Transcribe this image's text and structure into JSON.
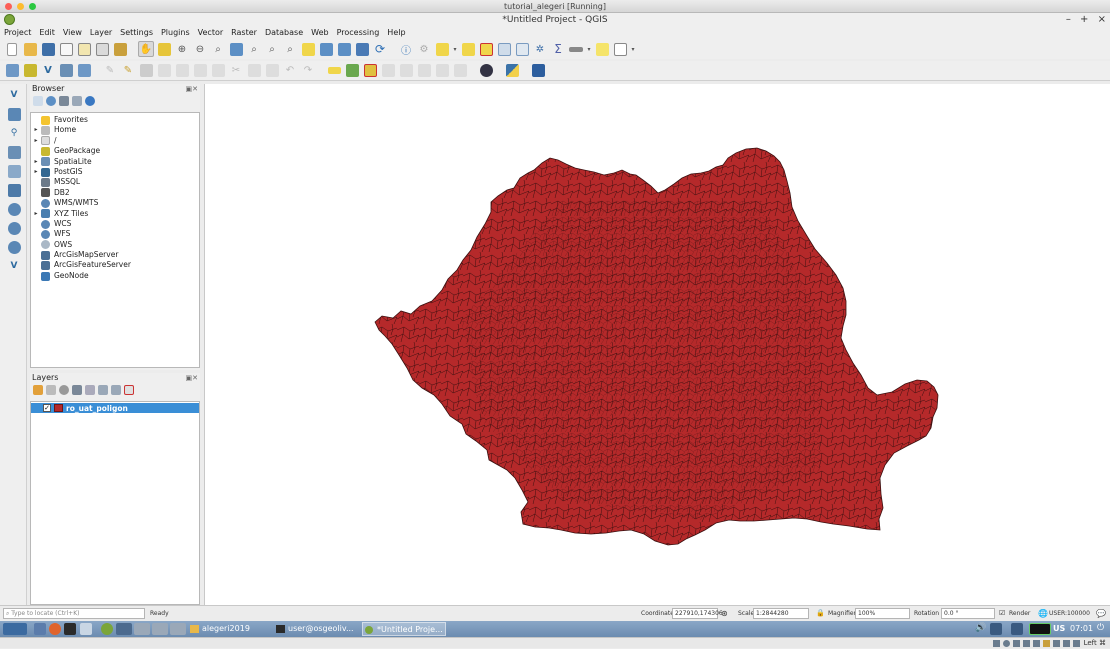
{
  "vbox_title": "tutorial_alegeri [Running]",
  "app_title": "*Untitled Project - QGIS",
  "window_controls": [
    "–",
    "+",
    "×"
  ],
  "menu": [
    "Project",
    "Edit",
    "View",
    "Layer",
    "Settings",
    "Plugins",
    "Vector",
    "Raster",
    "Database",
    "Web",
    "Processing",
    "Help"
  ],
  "browser": {
    "title": "Browser",
    "items": [
      {
        "label": "Favorites",
        "arrow": "",
        "icon": "#f4c430"
      },
      {
        "label": "Home",
        "arrow": "▸",
        "icon": "#bbbbbb"
      },
      {
        "label": "/",
        "arrow": "▸",
        "icon": "#dddddd"
      },
      {
        "label": "GeoPackage",
        "arrow": "",
        "icon": "#c8b830"
      },
      {
        "label": "SpatiaLite",
        "arrow": "▸",
        "icon": "#6a8fb5"
      },
      {
        "label": "PostGIS",
        "arrow": "▸",
        "icon": "#336791"
      },
      {
        "label": "MSSQL",
        "arrow": "",
        "icon": "#6c7a89"
      },
      {
        "label": "DB2",
        "arrow": "",
        "icon": "#555555"
      },
      {
        "label": "WMS/WMTS",
        "arrow": "",
        "icon": "#5a87b5"
      },
      {
        "label": "XYZ Tiles",
        "arrow": "▸",
        "icon": "#4a7fb0"
      },
      {
        "label": "WCS",
        "arrow": "",
        "icon": "#5a87b5"
      },
      {
        "label": "WFS",
        "arrow": "",
        "icon": "#5a87b5"
      },
      {
        "label": "OWS",
        "arrow": "",
        "icon": "#aab8c6"
      },
      {
        "label": "ArcGisMapServer",
        "arrow": "",
        "icon": "#4a6f95"
      },
      {
        "label": "ArcGisFeatureServer",
        "arrow": "",
        "icon": "#4a6f95"
      },
      {
        "label": "GeoNode",
        "arrow": "",
        "icon": "#3b78b5"
      }
    ]
  },
  "layers": {
    "title": "Layers",
    "items": [
      {
        "label": "ro_uat_poligon",
        "checked": true,
        "color": "#b5292a"
      }
    ]
  },
  "status": {
    "locate_placeholder": "Type to locate (Ctrl+K)",
    "ready": "Ready",
    "coordinate_label": "Coordinate",
    "coordinate_value": "227910,174306",
    "scale_label": "Scale",
    "scale_value": "1:2844280",
    "magnifier_label": "Magnifier",
    "magnifier_value": "100%",
    "rotation_label": "Rotation",
    "rotation_value": "0.0 °",
    "render_label": "Render",
    "crs": "USER:100000"
  },
  "taskbar": {
    "tasks": [
      "alegeri2019",
      "user@osgeoliv...",
      "*Untitled Proje..."
    ],
    "keyboard": "US",
    "time": "07:01"
  },
  "vbox_status": {
    "host_key": "Left ⌘"
  },
  "colors": {
    "polygon_fill": "#b5292a",
    "polygon_stroke": "#3a0f0f",
    "selection": "#3a8ed6"
  }
}
